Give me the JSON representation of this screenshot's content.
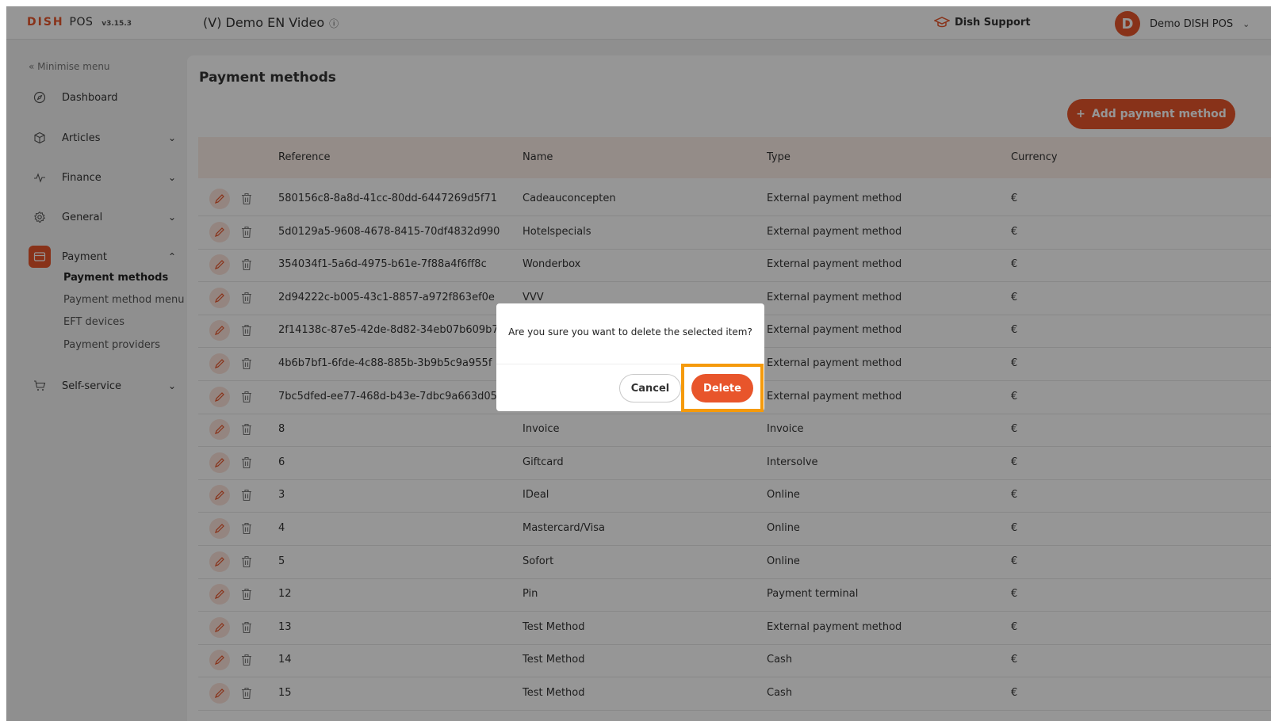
{
  "header": {
    "brand": "DISH",
    "brand_pos": "POS",
    "version": "v3.15.3",
    "venue": "(V) Demo EN Video",
    "support": "Dish Support",
    "user_initial": "D",
    "user_name": "Demo DISH POS"
  },
  "sidebar": {
    "minimise": "Minimise menu",
    "items": [
      {
        "label": "Dashboard",
        "icon": "compass-icon"
      },
      {
        "label": "Articles",
        "icon": "box-icon"
      },
      {
        "label": "Finance",
        "icon": "pulse-icon"
      },
      {
        "label": "General",
        "icon": "gear-icon"
      },
      {
        "label": "Payment",
        "icon": "card-icon"
      },
      {
        "label": "Self-service",
        "icon": "cart-icon"
      }
    ],
    "payment_sub": [
      "Payment methods",
      "Payment method menu",
      "EFT devices",
      "Payment providers"
    ]
  },
  "main": {
    "title": "Payment methods",
    "add_button": "Add payment method",
    "columns": [
      "Reference",
      "Name",
      "Type",
      "Currency"
    ],
    "rows": [
      {
        "ref": "580156c8-8a8d-41cc-80dd-6447269d5f71",
        "name": "Cadeauconcepten",
        "type": "External payment method",
        "currency": "€"
      },
      {
        "ref": "5d0129a5-9608-4678-8415-70df4832d990",
        "name": "Hotelspecials",
        "type": "External payment method",
        "currency": "€"
      },
      {
        "ref": "354034f1-5a6d-4975-b61e-7f88a4f6ff8c",
        "name": "Wonderbox",
        "type": "External payment method",
        "currency": "€"
      },
      {
        "ref": "2d94222c-b005-43c1-8857-a972f863ef0e",
        "name": "VVV",
        "type": "External payment method",
        "currency": "€"
      },
      {
        "ref": "2f14138c-87e5-42de-8d82-34eb07b609b7",
        "name": "",
        "type": "External payment method",
        "currency": "€"
      },
      {
        "ref": "4b6b7bf1-6fde-4c88-885b-3b9b5c9a955f",
        "name": "",
        "type": "External payment method",
        "currency": "€"
      },
      {
        "ref": "7bc5dfed-ee77-468d-b43e-7dbc9a663d05",
        "name": "",
        "type": "External payment method",
        "currency": "€"
      },
      {
        "ref": "8",
        "name": "Invoice",
        "type": "Invoice",
        "currency": "€"
      },
      {
        "ref": "6",
        "name": "Giftcard",
        "type": "Intersolve",
        "currency": "€"
      },
      {
        "ref": "3",
        "name": "IDeal",
        "type": "Online",
        "currency": "€"
      },
      {
        "ref": "4",
        "name": "Mastercard/Visa",
        "type": "Online",
        "currency": "€"
      },
      {
        "ref": "5",
        "name": "Sofort",
        "type": "Online",
        "currency": "€"
      },
      {
        "ref": "12",
        "name": "Pin",
        "type": "Payment terminal",
        "currency": "€"
      },
      {
        "ref": "13",
        "name": "Test Method",
        "type": "External payment method",
        "currency": "€"
      },
      {
        "ref": "14",
        "name": "Test Method",
        "type": "Cash",
        "currency": "€"
      },
      {
        "ref": "15",
        "name": "Test Method",
        "type": "Cash",
        "currency": "€"
      }
    ]
  },
  "modal": {
    "message": "Are you sure you want to delete the selected item?",
    "cancel": "Cancel",
    "delete": "Delete"
  },
  "colors": {
    "accent": "#e8552b",
    "highlight": "#f59a0b"
  }
}
